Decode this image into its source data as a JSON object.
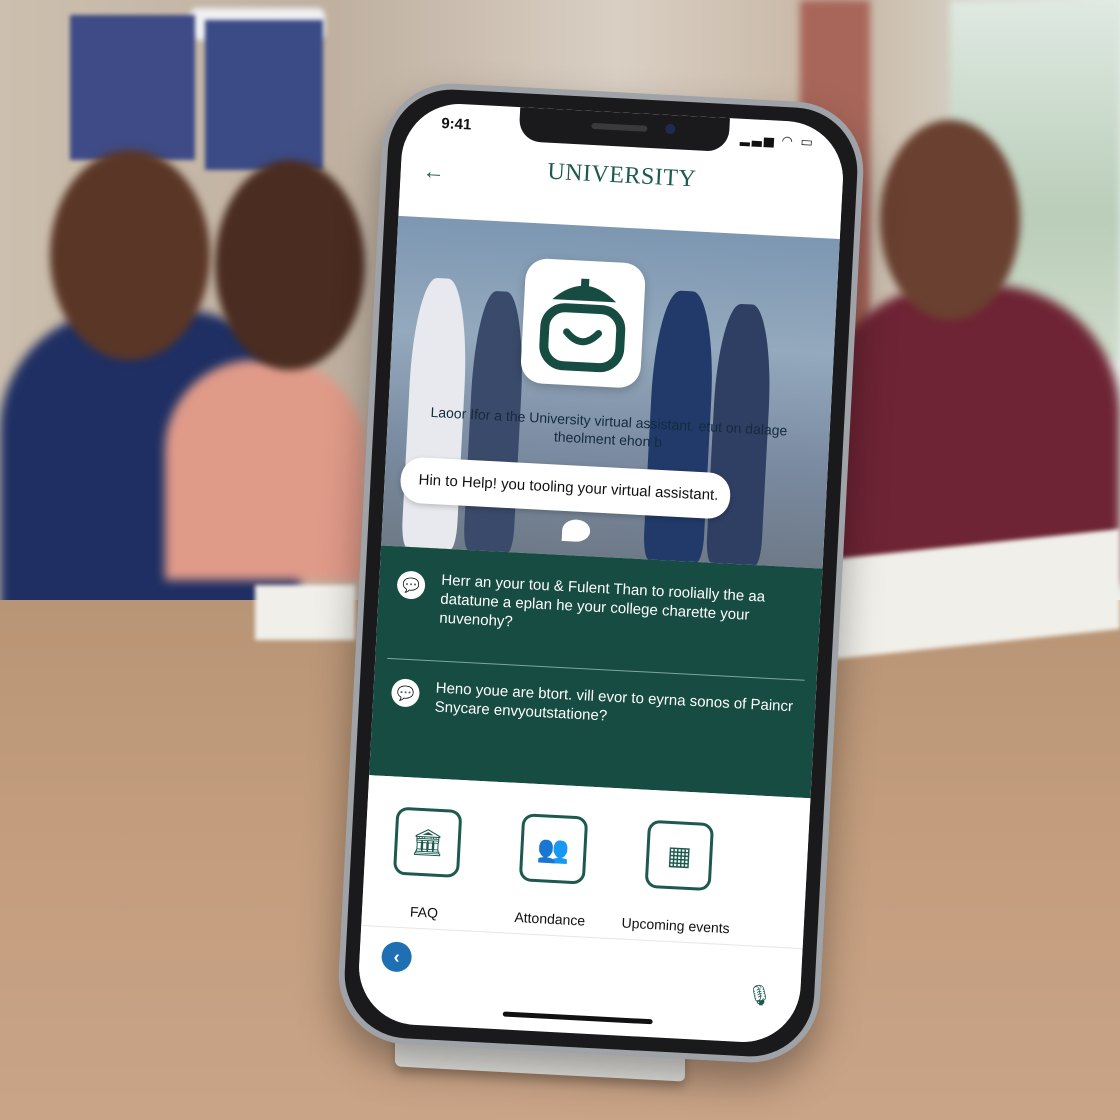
{
  "scene": {
    "banner_left": "",
    "banner_right": ""
  },
  "status_bar": {
    "time": "9:41",
    "icons": "signal-icon wifi-icon battery-icon"
  },
  "app_bar": {
    "back_icon": "arrow-left-icon",
    "brand_title": "UNIVERSITY",
    "brand_subtitle": ""
  },
  "hero": {
    "logo_icon": "assistant-logo-icon",
    "intro_text": "Laoor Ifor a the University virtual assistant. etut on dalage theolment ehon b",
    "bubble_text": "Hin to Help! you tooling your virtual assistant."
  },
  "messages": [
    {
      "icon": "chat-bubble-icon",
      "text": "Herr an your tou & Fulent Than to roolially the aa datatune a eplan he your college charette your nuvenohy?"
    },
    {
      "icon": "chat-bubble-icon",
      "text": "Heno youe are btort. vill evor to eyrna sonos of Paincr Snycare envyoutstatione?"
    }
  ],
  "quick_actions": [
    {
      "label": "FAQ",
      "icon": "university-building-icon"
    },
    {
      "label": "Attondance",
      "icon": "people-icon"
    },
    {
      "label": "Upcoming events",
      "icon": "calendar-grid-icon"
    }
  ],
  "bottom_bar": {
    "back_icon": "chevron-left-circle-icon",
    "mic_icon": "microphone-icon"
  },
  "colors": {
    "brand_green": "#164c41",
    "accent_blue": "#1f6fb3",
    "text_dark": "#111111"
  }
}
